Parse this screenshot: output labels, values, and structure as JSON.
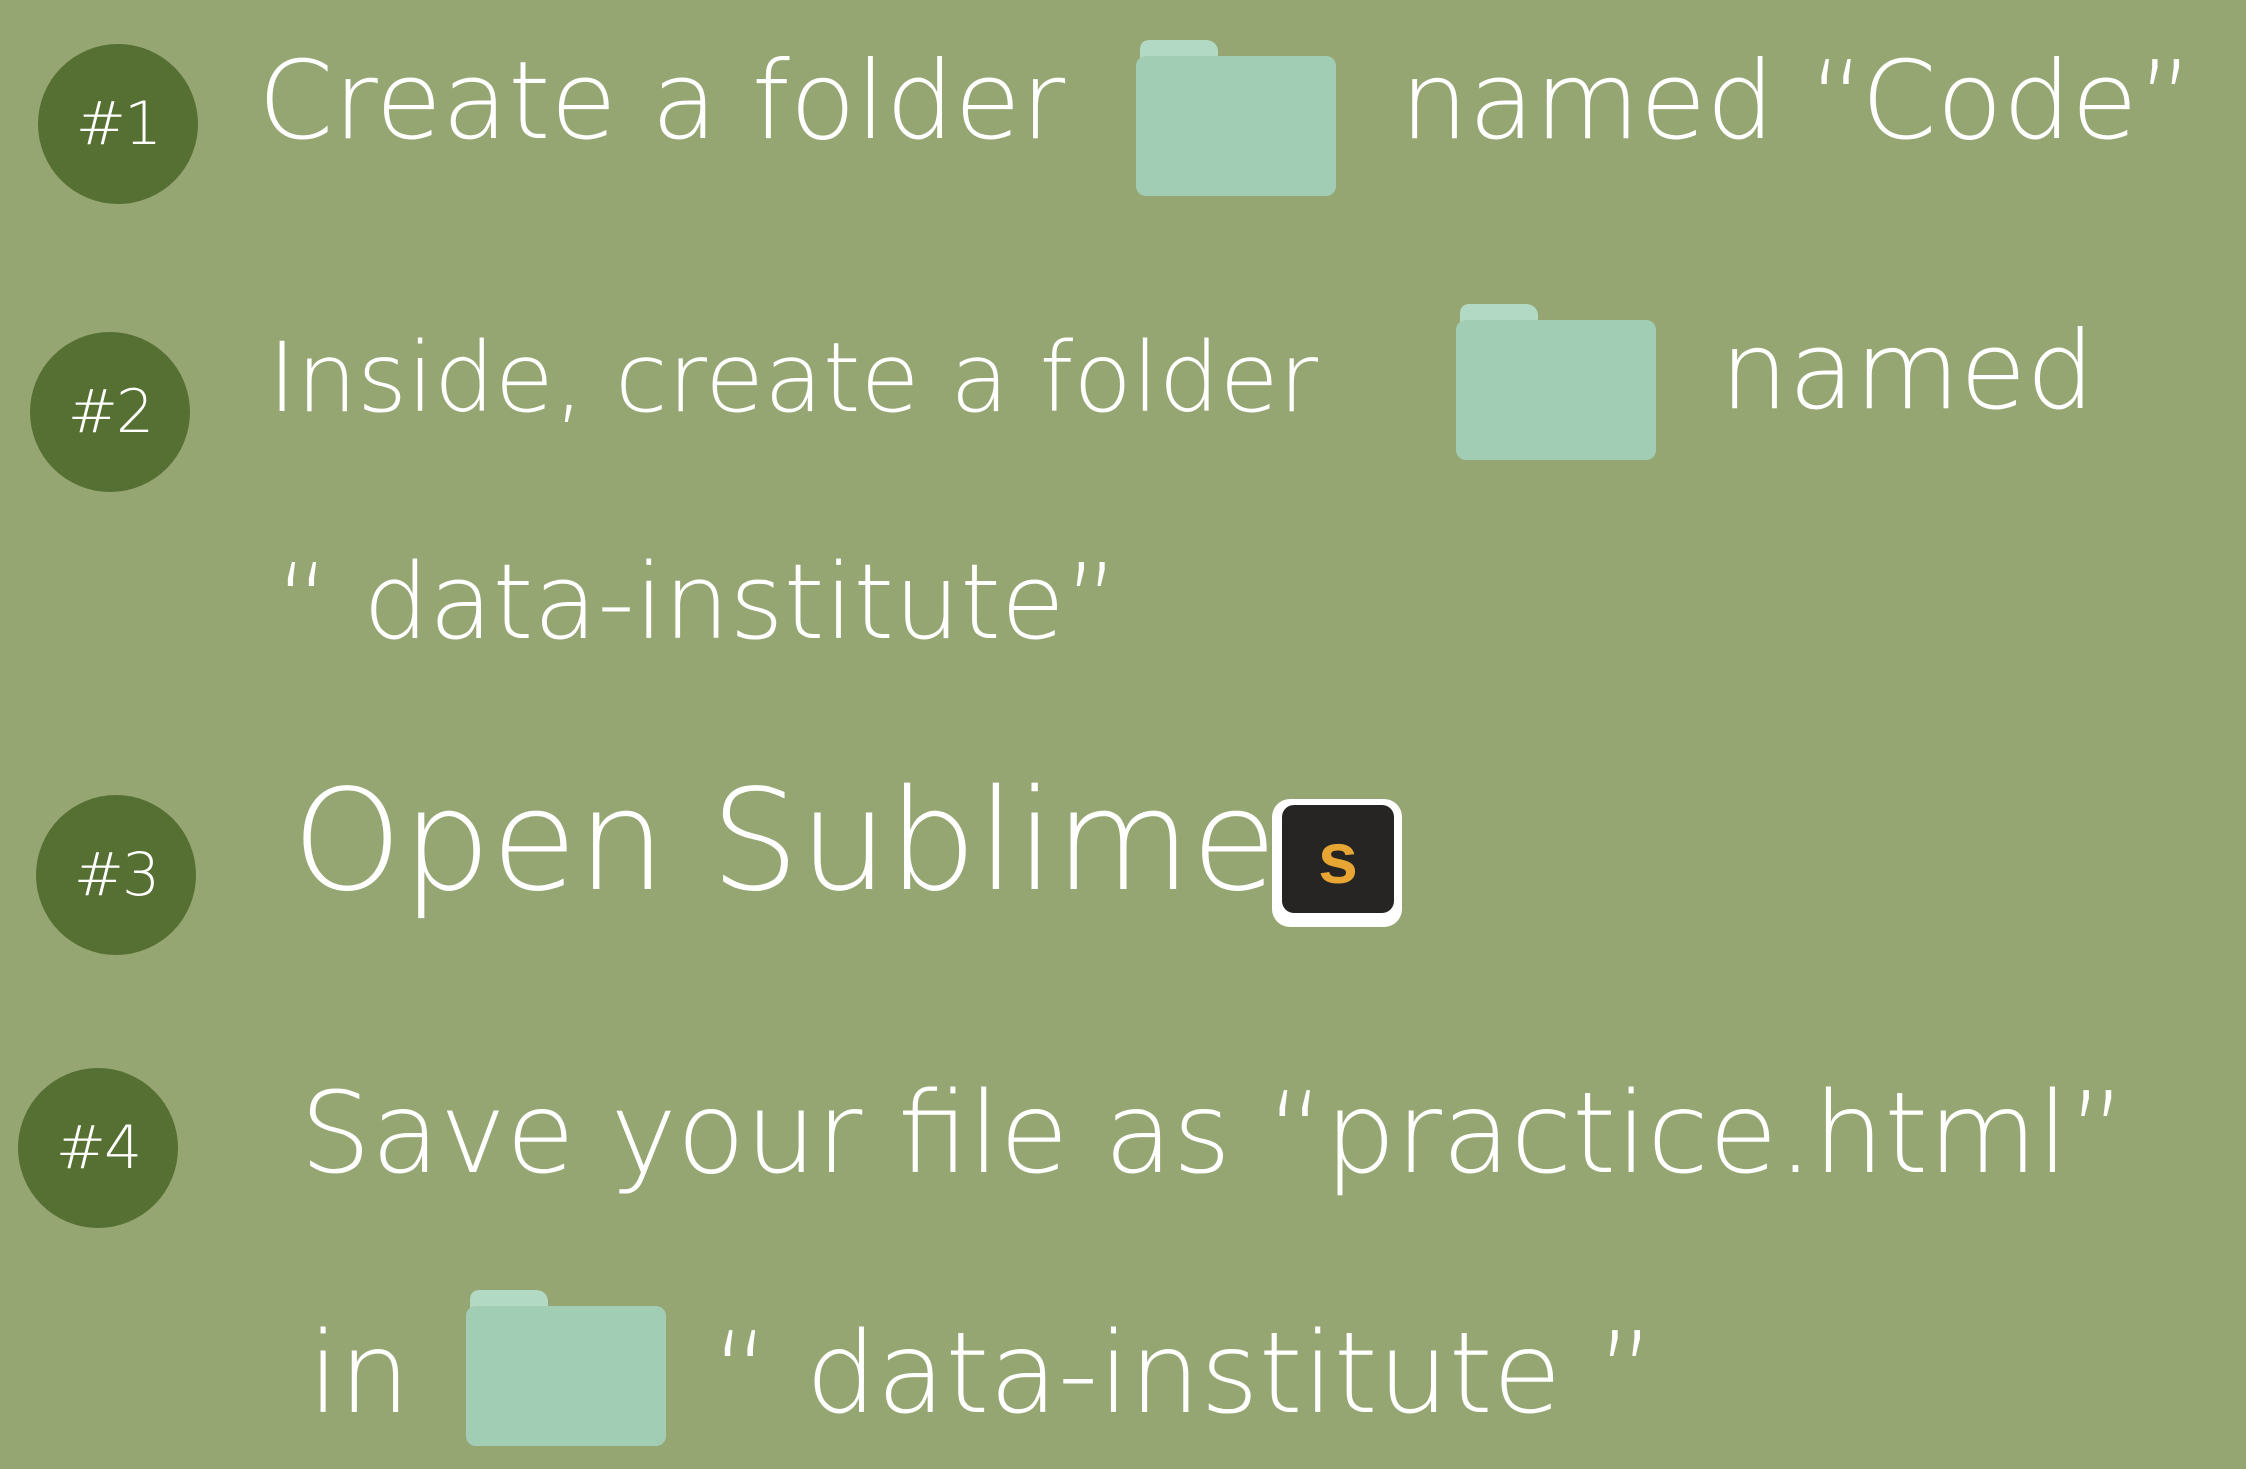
{
  "steps": [
    {
      "number": "#1",
      "text_before": "Create a folder",
      "text_after": "named “Code”"
    },
    {
      "number": "#2",
      "text_before": "Inside, create a folder",
      "text_after": "named",
      "text_line2": "“ data-institute”"
    },
    {
      "number": "#3",
      "text_before": "Open Sublime",
      "app_icon_letter": "s"
    },
    {
      "number": "#4",
      "text_before": "Save your file as “practice.html”",
      "text_line2_before": "in",
      "text_line2_after": "“ data-institute ”"
    }
  ],
  "colors": {
    "background": "#96a673",
    "badge": "#566f32",
    "folder": "#a2cdb5",
    "folder_tab": "#b2d9c4",
    "app_icon_bg": "#262523",
    "app_icon_letter": "#e7a633"
  },
  "icons": {
    "folder": "folder-icon",
    "app": "sublime-text-icon"
  }
}
